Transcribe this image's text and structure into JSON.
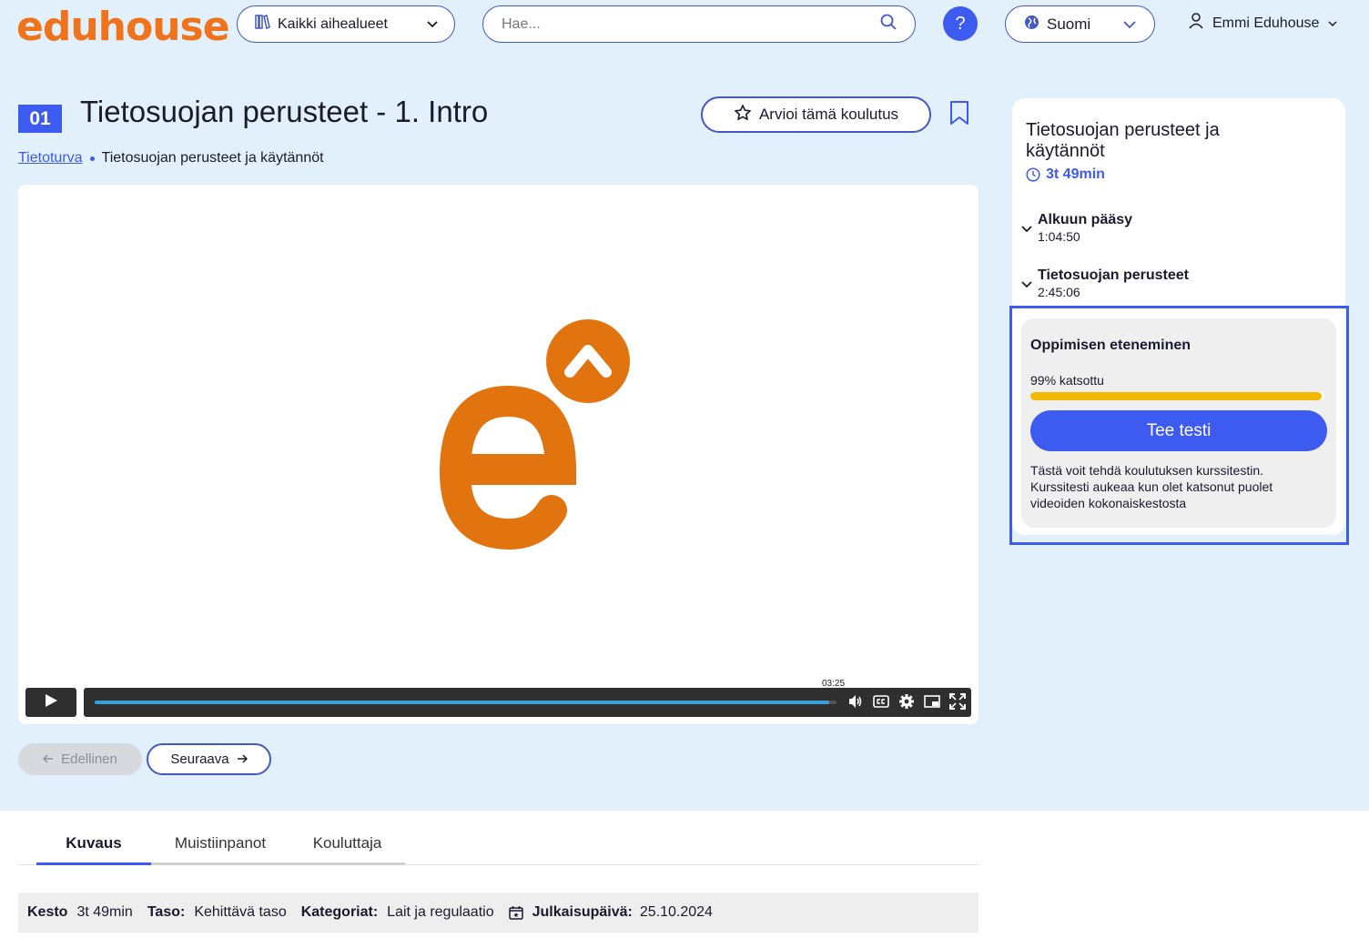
{
  "header": {
    "logo_text": "eduhouse",
    "logo_mark": "^",
    "category_label": "Kaikki aihealueet",
    "search_placeholder": "Hae...",
    "help_label": "?",
    "language_label": "Suomi",
    "user_name": "Emmi Eduhouse"
  },
  "course": {
    "number_badge": "01",
    "title": "Tietosuojan perusteet - 1. Intro",
    "rate_label": "Arvioi tämä koulutus",
    "breadcrumb_link": "Tietoturva",
    "breadcrumb_current": "Tietosuojan perusteet ja käytännöt"
  },
  "video": {
    "time_tooltip": "03:25",
    "progress": 0.99
  },
  "nav": {
    "prev_label": "Edellinen",
    "next_label": "Seuraava"
  },
  "tabs": [
    {
      "label": "Kuvaus",
      "active": true
    },
    {
      "label": "Muistiinpanot",
      "active": false
    },
    {
      "label": "Kouluttaja",
      "active": false
    }
  ],
  "meta": {
    "duration_label": "Kesto",
    "duration_value": "3t 49min",
    "level_label": "Taso:",
    "level_value": "Kehittävä taso",
    "categories_label": "Kategoriat:",
    "categories_value": "Lait ja regulaatio",
    "published_label": "Julkaisupäivä:",
    "published_value": "25.10.2024"
  },
  "side": {
    "title": "Tietosuojan perusteet ja käytännöt",
    "duration": "3t 49min",
    "sections": [
      {
        "title": "Alkuun pääsy",
        "duration": "1:04:50"
      },
      {
        "title": "Tietosuojan perusteet",
        "duration": "2:45:06"
      }
    ],
    "progress_title": "Oppimisen eteneminen",
    "progress_text": "99% katsottu",
    "progress_value": 0.99,
    "test_button": "Tee testi",
    "test_description": "Tästä voit tehdä koulutuksen kurssitestin. Kurssitesti aukeaa kun olet katsonut puolet videoiden kokonaiskestosta"
  },
  "colors": {
    "brand_orange": "#f0731c",
    "accent_blue": "#3d5af1",
    "progress_yellow": "#f5b800",
    "page_bg": "#e2f0fc"
  }
}
